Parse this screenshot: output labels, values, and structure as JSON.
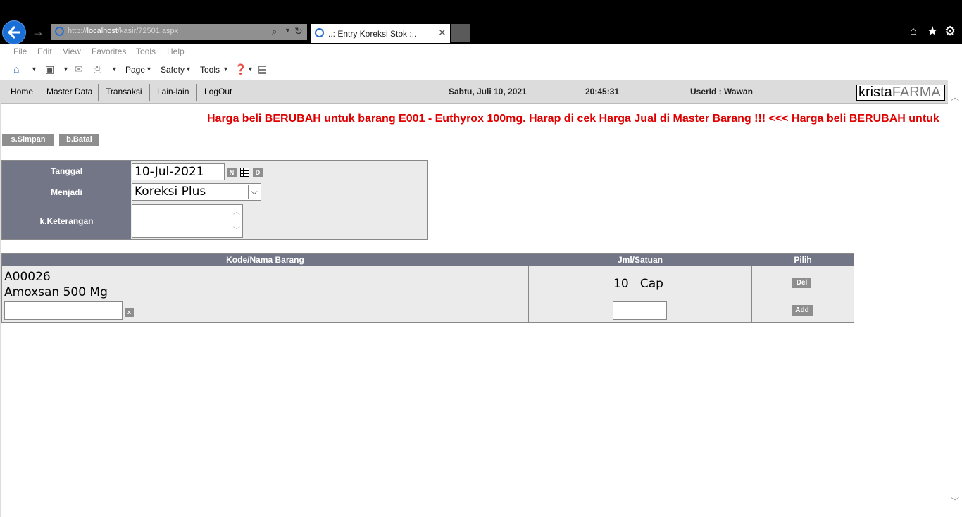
{
  "browser": {
    "url_prefix": "http://",
    "url_host": "localhost",
    "url_path": "/kasir/72501.aspx",
    "tab_title": "..: Entry Koreksi Stok :..",
    "menu": [
      "File",
      "Edit",
      "View",
      "Favorites",
      "Tools",
      "Help"
    ],
    "command_bar": {
      "page": "Page",
      "safety": "Safety",
      "tools": "Tools"
    }
  },
  "nav": {
    "items": [
      "Home",
      "Master Data",
      "Transaksi",
      "Lain-lain",
      "LogOut"
    ],
    "date": "Sabtu, Juli 10, 2021",
    "time": "20:45:31",
    "user": "UserId : Wawan",
    "logo_part1": "krista",
    "logo_part2": "FARMA"
  },
  "marquee": "Harga beli BERUBAH untuk barang E001 - Euthyrox 100mg. Harap di cek Harga Jual di Master Barang !!!   <<<   Harga beli BERUBAH untuk",
  "actions": {
    "save": "s.Simpan",
    "cancel": "b.Batal"
  },
  "form": {
    "tanggal_label": "Tanggal",
    "tanggal_value": "10-Jul-2021",
    "now_btn": "N",
    "d_btn": "D",
    "menjadi_label": "Menjadi",
    "menjadi_value": "Koreksi Plus",
    "keterangan_label": "k.Keterangan",
    "keterangan_value": ""
  },
  "table": {
    "headers": [
      "Kode/Nama Barang",
      "Jml/Satuan",
      "Pilih"
    ],
    "rows": [
      {
        "code": "A00026",
        "name": "Amoxsan 500 Mg",
        "qty": "10",
        "unit": "Cap",
        "action": "Del"
      }
    ],
    "new_row": {
      "clear_btn": "x",
      "add_btn": "Add"
    }
  }
}
